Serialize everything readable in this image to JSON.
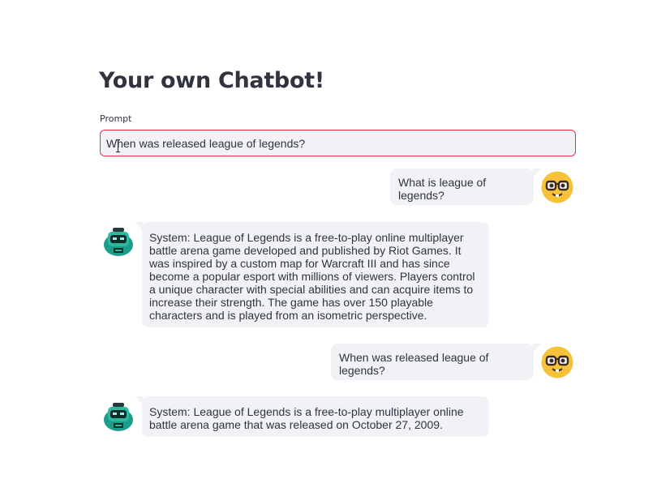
{
  "page": {
    "title": "Your own Chatbot!"
  },
  "prompt": {
    "label": "Prompt",
    "value": "When was released league of legends?"
  },
  "messages": [
    {
      "role": "user",
      "avatar_icon": "nerd-face-icon",
      "text": "What is league of legends?"
    },
    {
      "role": "bot",
      "avatar_icon": "robot-icon",
      "text": "System: League of Legends is a free-to-play online multiplayer battle arena game developed and published by Riot Games. It was inspired by a custom map for Warcraft III and has since become a popular esport with millions of viewers. Players control a unique character with special abilities and can acquire items to increase their strength. The game has over 150 playable characters and is played from an isometric perspective."
    },
    {
      "role": "user",
      "avatar_icon": "nerd-face-icon",
      "text": "When was released league of legends?"
    },
    {
      "role": "bot",
      "avatar_icon": "robot-icon",
      "text": "System: League of Legends is a free-to-play multiplayer online battle arena game that was released on October 27, 2009."
    }
  ],
  "colors": {
    "bubble_bg": "#f0f2f6",
    "input_border": "#e0333f",
    "user_avatar": "#f7c23a",
    "bot_avatar": "#1e9c8a"
  }
}
